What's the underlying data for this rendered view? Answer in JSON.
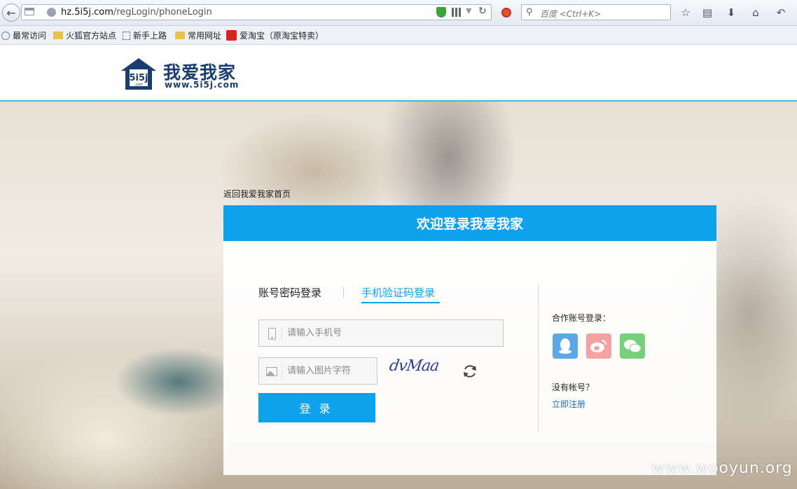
{
  "browser": {
    "url_host": "hz.5i5j.com",
    "url_path": "/regLogin/phoneLogin",
    "search_placeholder": "百度 <Ctrl+K>",
    "bookmarks": [
      {
        "label": "最常访问",
        "icon": "recent-icon"
      },
      {
        "label": "火狐官方站点",
        "icon": "folder-icon"
      },
      {
        "label": "新手上路",
        "icon": "page-icon"
      },
      {
        "label": "常用网址",
        "icon": "folder-icon"
      },
      {
        "label": "爱淘宝（原淘宝特卖）",
        "icon": "taobao-icon"
      }
    ]
  },
  "header": {
    "logo_house_text": "5i5j",
    "logo_house_sub": ".com",
    "logo_name": "我爱我家",
    "logo_url": "www.5i5j.com"
  },
  "login": {
    "back_link": "返回我爱我家首页",
    "title": "欢迎登录我爱我家",
    "tabs": [
      "账号密码登录",
      "手机验证码登录"
    ],
    "active_tab": 1,
    "phone_placeholder": "请输入手机号",
    "captcha_placeholder": "请输入图片字符",
    "captcha_text": "dvMaa",
    "submit_label": "登录",
    "partner_label": "合作账号登录：",
    "partners": [
      "qq",
      "weibo",
      "wechat"
    ],
    "no_account": "没有帐号？",
    "register_link": "立即注册"
  },
  "colors": {
    "accent": "#0ea1ec",
    "qq": "#5aa9e6",
    "weibo": "#f3a2a2",
    "wechat": "#79d07a"
  },
  "watermark": "www.wooyun.org"
}
